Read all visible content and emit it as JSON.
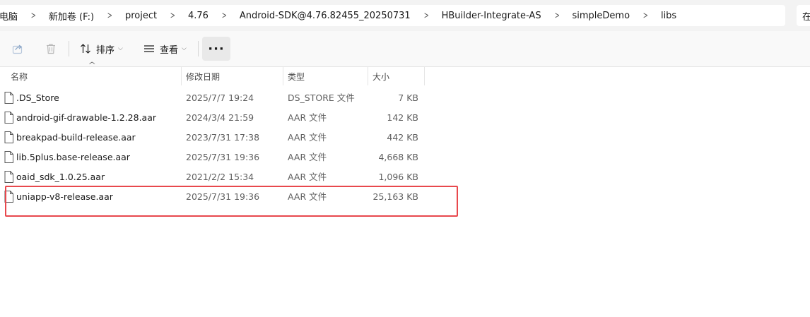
{
  "breadcrumbs": [
    "电脑",
    "新加卷 (F:)",
    "project",
    "4.76",
    "Android-SDK@4.76.82455_20250731",
    "HBuilder-Integrate-AS",
    "simpleDemo",
    "libs"
  ],
  "search": {
    "placeholder": "在"
  },
  "toolbar": {
    "sort_label": "排序",
    "view_label": "查看",
    "more_label": "···"
  },
  "columns": {
    "name": "名称",
    "date": "修改日期",
    "type": "类型",
    "size": "大小"
  },
  "files": [
    {
      "name": ".DS_Store",
      "date": "2025/7/7 19:24",
      "type": "DS_STORE 文件",
      "size": "7 KB"
    },
    {
      "name": "android-gif-drawable-1.2.28.aar",
      "date": "2024/3/4 21:59",
      "type": "AAR 文件",
      "size": "142 KB"
    },
    {
      "name": "breakpad-build-release.aar",
      "date": "2023/7/31 17:38",
      "type": "AAR 文件",
      "size": "442 KB"
    },
    {
      "name": "lib.5plus.base-release.aar",
      "date": "2025/7/31 19:36",
      "type": "AAR 文件",
      "size": "4,668 KB"
    },
    {
      "name": "oaid_sdk_1.0.25.aar",
      "date": "2021/2/2 15:34",
      "type": "AAR 文件",
      "size": "1,096 KB"
    },
    {
      "name": "uniapp-v8-release.aar",
      "date": "2025/7/31 19:36",
      "type": "AAR 文件",
      "size": "25,163 KB"
    }
  ],
  "colors": {
    "highlight": "#e8484d"
  }
}
